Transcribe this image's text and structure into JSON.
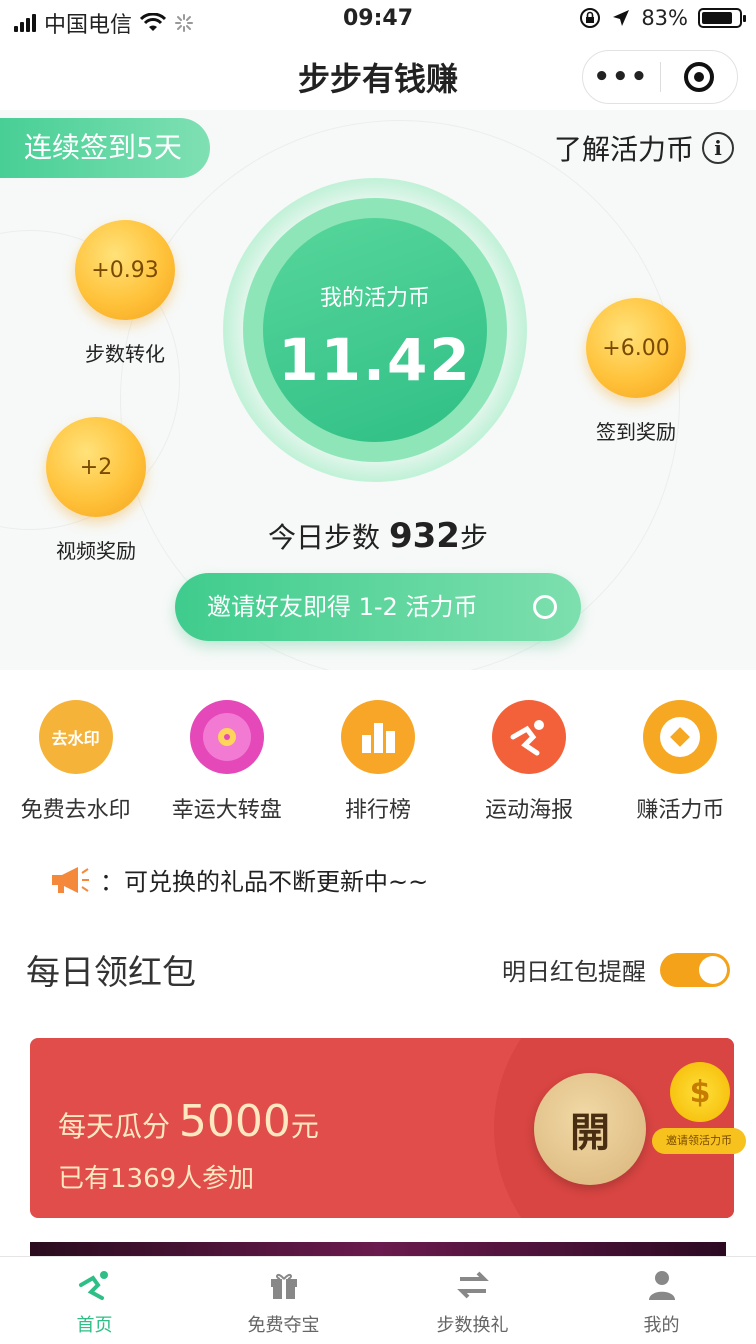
{
  "status_bar": {
    "carrier": "中国电信",
    "time": "09:47",
    "battery": "83%",
    "battery_level": 0.83
  },
  "nav": {
    "title": "步步有钱赚"
  },
  "hero": {
    "checkin_badge": "连续签到5天",
    "learn_link": "了解活力币",
    "bubbles": [
      {
        "value": "+0.93",
        "label": "步数转化"
      },
      {
        "value": "+6.00",
        "label": "签到奖励"
      },
      {
        "value": "+2",
        "label": "视频奖励"
      }
    ],
    "balance_caption": "我的活力币",
    "balance_value": "11.42",
    "steps_prefix": "今日步数",
    "steps_value": "932",
    "steps_unit": "步",
    "invite_text": "邀请好友即得 1-2 活力币"
  },
  "quick_menu": [
    {
      "label": "免费去水印",
      "icon": "watermark-icon",
      "color": "#f6b33a",
      "icon_text": "去水印"
    },
    {
      "label": "幸运大转盘",
      "icon": "wheel-icon",
      "color": "#e548b8"
    },
    {
      "label": "排行榜",
      "icon": "chart-icon",
      "color": "#f7a628"
    },
    {
      "label": "运动海报",
      "icon": "runner-icon",
      "color": "#f2613a"
    },
    {
      "label": "赚活力币",
      "icon": "coin-icon",
      "color": "#f6a822"
    }
  ],
  "notice": {
    "text": "：可兑换的礼品不断更新中~~"
  },
  "red_packet": {
    "section_title": "每日领红包",
    "remind_label": "明日红包提醒",
    "remind_on": true,
    "line1_prefix": "每天瓜分 ",
    "line1_amount": "5000",
    "line1_unit": "元",
    "line2": "已有1369人参加",
    "open_label": "開",
    "coin_symbol": "$",
    "coin_tag": "邀请领活力币"
  },
  "tabs": [
    {
      "label": "首页",
      "icon": "run-icon",
      "active": true
    },
    {
      "label": "免费夺宝",
      "icon": "gift-icon",
      "active": false
    },
    {
      "label": "步数换礼",
      "icon": "exchange-icon",
      "active": false
    },
    {
      "label": "我的",
      "icon": "user-icon",
      "active": false
    }
  ],
  "colors": {
    "primary_green": "#3fcc8d",
    "packet_red": "#e04d4a",
    "coin_gold": "#ffc23a",
    "toggle_orange": "#f5a21b"
  }
}
